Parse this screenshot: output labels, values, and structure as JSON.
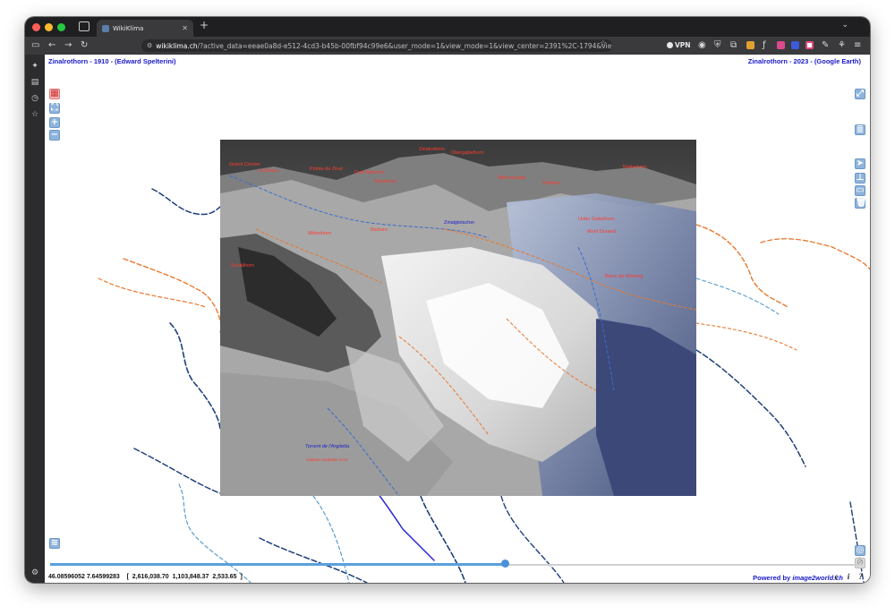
{
  "browser": {
    "tab_title": "WikiKlima",
    "new_tab": "+",
    "url_host": "wikiklima.ch",
    "url_rest": "/?active_data=eeae0a8d-e512-4cd3-b45b-00fbf94c99e6&user_mode=1&view_mode=1&view_center=2391%2C-1794&view_rotation=0&view",
    "vpn_label": "VPN"
  },
  "page": {
    "title_left": "Zinalrothorn - 1910 - (Edward Spelterini)",
    "title_right": "Zinalrothorn - 2023 - (Google Earth)",
    "zoom_in": "+",
    "zoom_out": "−",
    "coords": "46.08596052 7.64599283    [  2,616,038.70  1,103,848.37  2,533.65  ]",
    "powered_prefix": "Powered by ",
    "powered_brand": "image2world.ch",
    "bottom_icons": "c i ?",
    "slider_value": 0.56
  },
  "peaks": [
    {
      "name": "Grand Cornier",
      "color": "#ff3b30"
    },
    {
      "name": "Lo Besso",
      "color": "#ff3b30"
    },
    {
      "name": "Pointe de Zinal",
      "color": "#ff3b30"
    },
    {
      "name": "Dent Blanche",
      "color": "#ff3b30"
    },
    {
      "name": "Zinalrothorn",
      "color": "#ff3b30"
    },
    {
      "name": "Obergabelhorn",
      "color": "#ff3b30"
    },
    {
      "name": "Wellenkuppe",
      "color": "#ff3b30"
    },
    {
      "name": "Trifthorn",
      "color": "#ff3b30"
    },
    {
      "name": "Mont Durand",
      "color": "#ff3b30"
    },
    {
      "name": "Blanc de Moming",
      "color": "#ff3b30"
    },
    {
      "name": "Schalihorn",
      "color": "#ff3b30"
    },
    {
      "name": "Weisshorn",
      "color": "#ff3b30"
    },
    {
      "name": "Bishorn",
      "color": "#ff3b30"
    },
    {
      "name": "Stockhorn",
      "color": "#ff3b30"
    },
    {
      "name": "Unter Gabelhorn",
      "color": "#ff3b30"
    },
    {
      "name": "Matterhorn",
      "color": "#ff3b30"
    }
  ],
  "route_labels": [
    {
      "name": "Torrent de l'Argitetta",
      "color": "#2020c8"
    },
    {
      "name": "Cabane Arpitettaz CAS",
      "color": "#ff3b30"
    },
    {
      "name": "Zinalgletscher",
      "color": "#2020c8"
    }
  ],
  "colors": {
    "title": "#1a1ac8",
    "orange_trail": "#e8772e",
    "navy_trail": "#1f3f7a",
    "light_trail": "#5a9ccc",
    "photo_sky": "#6e6e6e"
  }
}
